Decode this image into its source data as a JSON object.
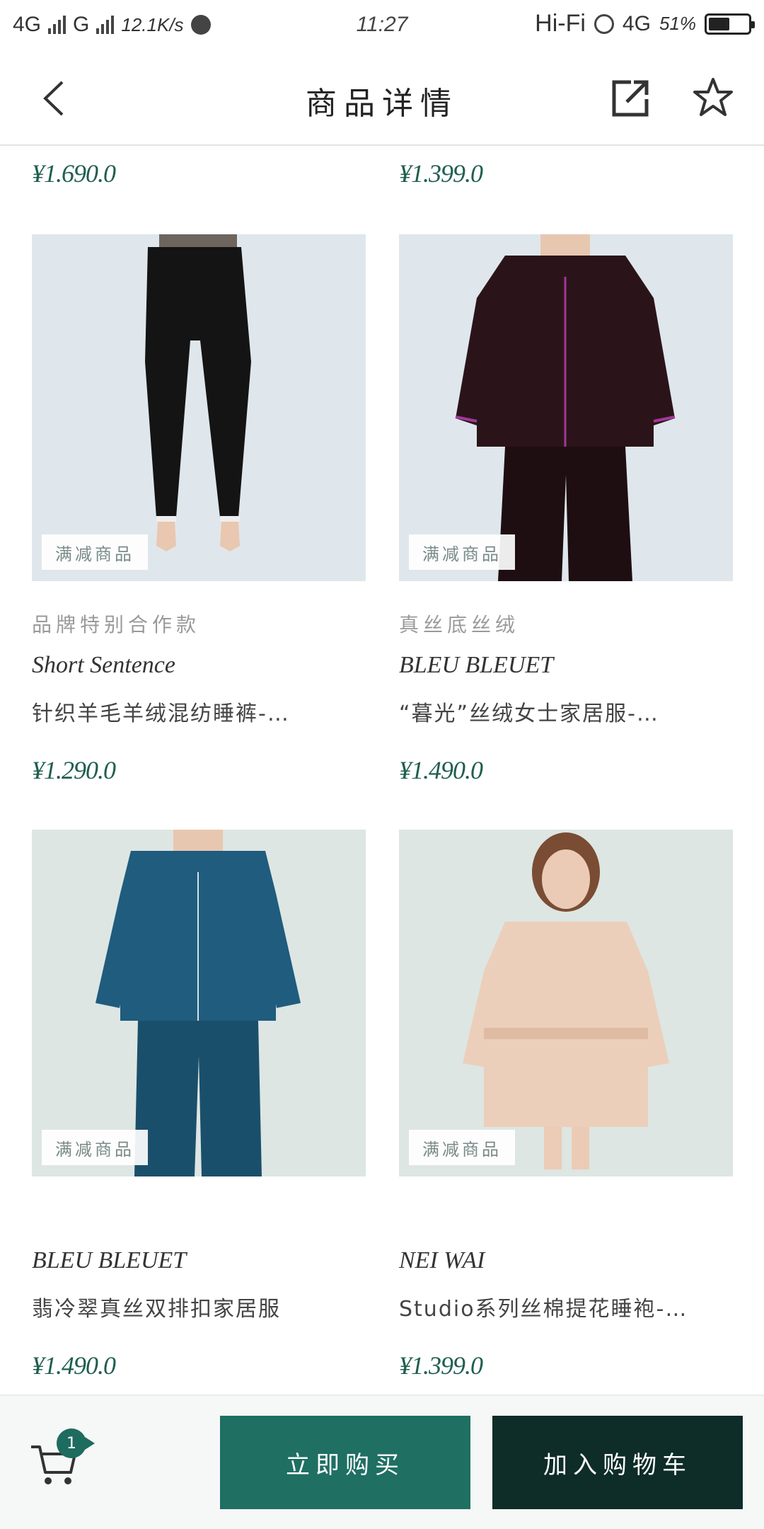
{
  "status_bar": {
    "network1": "4G",
    "network2": "G",
    "speed": "12.1K/s",
    "time": "11:27",
    "hifi": "Hi-Fi",
    "network3": "4G",
    "battery": "51%"
  },
  "nav": {
    "title": "商品详情",
    "back_icon": "chevron-left-icon",
    "share_icon": "share-icon",
    "favorite_icon": "star-icon"
  },
  "top_prices": [
    "¥1.690.0",
    "¥1.399.0"
  ],
  "products": [
    {
      "badge": "满减商品",
      "tag": "品牌特别合作款",
      "brand": "Short Sentence",
      "desc": "针织羊毛羊绒混纺睡裤-…",
      "price": "¥1.290.0"
    },
    {
      "badge": "满减商品",
      "tag": "真丝底丝绒",
      "brand": "BLEU BLEUET",
      "desc": "“暮光”丝绒女士家居服-…",
      "price": "¥1.490.0"
    },
    {
      "badge": "满减商品",
      "tag": "",
      "brand": "BLEU BLEUET",
      "desc": "翡冷翠真丝双排扣家居服",
      "price": "¥1.490.0"
    },
    {
      "badge": "满减商品",
      "tag": "",
      "brand": "NEI WAI",
      "desc": "Studio系列丝棉提花睡袍-…",
      "price": "¥1.399.0"
    }
  ],
  "bottom_bar": {
    "cart_count": "1",
    "buy_now": "立即购买",
    "add_to_cart": "加入购物车"
  },
  "colors": {
    "accent": "#1f6f63",
    "dark": "#0e2c28",
    "price": "#1f5e50"
  }
}
